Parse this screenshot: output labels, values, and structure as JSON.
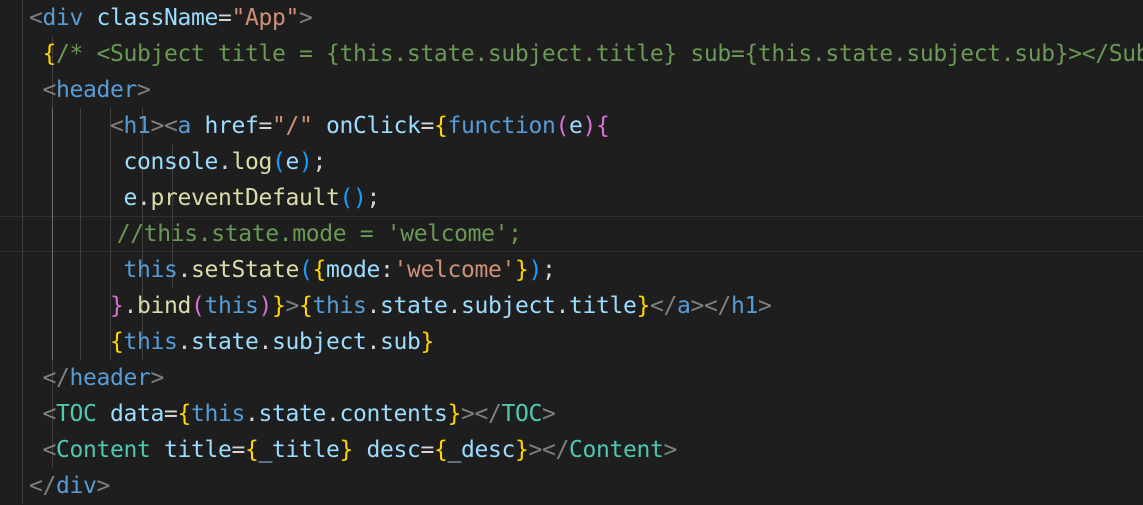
{
  "editor": {
    "lines": [
      {
        "indent": 2,
        "guides": 1,
        "tokens": [
          [
            "punct",
            "<"
          ],
          [
            "tag",
            "div"
          ],
          [
            "op",
            " "
          ],
          [
            "attr",
            "className"
          ],
          [
            "op",
            "="
          ],
          [
            "str",
            "\"App\""
          ],
          [
            "punct",
            ">"
          ]
        ]
      },
      {
        "indent": 3,
        "guides": 2,
        "tokens": [
          [
            "b1",
            "{"
          ],
          [
            "comment",
            "/* <Subject title = {this.state.subject.title} sub={this.state.subject.sub}></Subject> */"
          ],
          [
            "b1",
            "}"
          ]
        ]
      },
      {
        "indent": 3,
        "guides": 2,
        "tokens": [
          [
            "punct",
            "<"
          ],
          [
            "tag",
            "header"
          ],
          [
            "punct",
            ">"
          ]
        ]
      },
      {
        "indent": 8,
        "guides": 5,
        "tokens": [
          [
            "punct",
            "<"
          ],
          [
            "tag",
            "h1"
          ],
          [
            "punct",
            "><"
          ],
          [
            "tag",
            "a"
          ],
          [
            "op",
            " "
          ],
          [
            "attr",
            "href"
          ],
          [
            "op",
            "="
          ],
          [
            "str",
            "\"/\""
          ],
          [
            "op",
            " "
          ],
          [
            "attr",
            "onClick"
          ],
          [
            "op",
            "="
          ],
          [
            "b1",
            "{"
          ],
          [
            "kw",
            "function"
          ],
          [
            "b2",
            "("
          ],
          [
            "attr",
            "e"
          ],
          [
            "b2",
            ")"
          ],
          [
            "b2",
            "{"
          ]
        ]
      },
      {
        "indent": 9,
        "guides": 6,
        "tokens": [
          [
            "attr",
            "console"
          ],
          [
            "op",
            "."
          ],
          [
            "fn",
            "log"
          ],
          [
            "b3",
            "("
          ],
          [
            "attr",
            "e"
          ],
          [
            "b3",
            ")"
          ],
          [
            "op",
            ";"
          ]
        ]
      },
      {
        "indent": 9,
        "guides": 6,
        "tokens": [
          [
            "attr",
            "e"
          ],
          [
            "op",
            "."
          ],
          [
            "fn",
            "preventDefault"
          ],
          [
            "b3",
            "()"
          ],
          [
            "op",
            ";"
          ]
        ]
      },
      {
        "indent": 8.5,
        "guides": 6,
        "current": true,
        "tokens": [
          [
            "comment",
            "//this.state.mode = 'welcome';"
          ]
        ]
      },
      {
        "indent": 9,
        "guides": 6,
        "tokens": [
          [
            "kw",
            "this"
          ],
          [
            "op",
            "."
          ],
          [
            "fn",
            "setState"
          ],
          [
            "b3",
            "("
          ],
          [
            "b1",
            "{"
          ],
          [
            "attr",
            "mode"
          ],
          [
            "op",
            ":"
          ],
          [
            "str",
            "'welcome'"
          ],
          [
            "b1",
            "}"
          ],
          [
            "b3",
            ")"
          ],
          [
            "op",
            ";"
          ]
        ]
      },
      {
        "indent": 8,
        "guides": 5,
        "tokens": [
          [
            "b2",
            "}"
          ],
          [
            "op",
            "."
          ],
          [
            "fn",
            "bind"
          ],
          [
            "b2",
            "("
          ],
          [
            "kw",
            "this"
          ],
          [
            "b2",
            ")"
          ],
          [
            "b1",
            "}"
          ],
          [
            "punct",
            ">"
          ],
          [
            "b1",
            "{"
          ],
          [
            "kw",
            "this"
          ],
          [
            "op",
            "."
          ],
          [
            "attr",
            "state"
          ],
          [
            "op",
            "."
          ],
          [
            "attr",
            "subject"
          ],
          [
            "op",
            "."
          ],
          [
            "attr",
            "title"
          ],
          [
            "b1",
            "}"
          ],
          [
            "punct",
            "</"
          ],
          [
            "tag",
            "a"
          ],
          [
            "punct",
            "></"
          ],
          [
            "tag",
            "h1"
          ],
          [
            "punct",
            ">"
          ]
        ]
      },
      {
        "indent": 8,
        "guides": 5,
        "tokens": [
          [
            "b1",
            "{"
          ],
          [
            "kw",
            "this"
          ],
          [
            "op",
            "."
          ],
          [
            "attr",
            "state"
          ],
          [
            "op",
            "."
          ],
          [
            "attr",
            "subject"
          ],
          [
            "op",
            "."
          ],
          [
            "attr",
            "sub"
          ],
          [
            "b1",
            "}"
          ]
        ]
      },
      {
        "indent": 3,
        "guides": 2,
        "tokens": [
          [
            "punct",
            "</"
          ],
          [
            "tag",
            "header"
          ],
          [
            "punct",
            ">"
          ]
        ]
      },
      {
        "indent": 3,
        "guides": 2,
        "tokens": [
          [
            "punct",
            "<"
          ],
          [
            "comp",
            "TOC"
          ],
          [
            "op",
            " "
          ],
          [
            "attr",
            "data"
          ],
          [
            "op",
            "="
          ],
          [
            "b1",
            "{"
          ],
          [
            "kw",
            "this"
          ],
          [
            "op",
            "."
          ],
          [
            "attr",
            "state"
          ],
          [
            "op",
            "."
          ],
          [
            "attr",
            "contents"
          ],
          [
            "b1",
            "}"
          ],
          [
            "punct",
            "></"
          ],
          [
            "comp",
            "TOC"
          ],
          [
            "punct",
            ">"
          ]
        ]
      },
      {
        "indent": 3,
        "guides": 2,
        "tokens": [
          [
            "punct",
            "<"
          ],
          [
            "comp",
            "Content"
          ],
          [
            "op",
            " "
          ],
          [
            "attr",
            "title"
          ],
          [
            "op",
            "="
          ],
          [
            "b1",
            "{"
          ],
          [
            "attr",
            "_title"
          ],
          [
            "b1",
            "}"
          ],
          [
            "op",
            " "
          ],
          [
            "attr",
            "desc"
          ],
          [
            "op",
            "="
          ],
          [
            "b1",
            "{"
          ],
          [
            "attr",
            "_desc"
          ],
          [
            "b1",
            "}"
          ],
          [
            "punct",
            "></"
          ],
          [
            "comp",
            "Content"
          ],
          [
            "punct",
            ">"
          ]
        ]
      },
      {
        "indent": 2,
        "guides": 1,
        "tokens": [
          [
            "punct",
            "</"
          ],
          [
            "tag",
            "div"
          ],
          [
            "punct",
            ">"
          ]
        ]
      }
    ]
  }
}
